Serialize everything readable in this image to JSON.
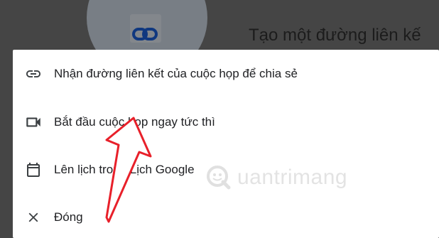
{
  "background": {
    "title": "Tạo một đường liên kế",
    "icon": "link-icon"
  },
  "menu": {
    "items": [
      {
        "label": "Nhận đường liên kết của cuộc họp để chia sẻ",
        "icon": "link-icon"
      },
      {
        "label": "Bắt đầu cuộc họp ngay tức thì",
        "icon": "video-camera-icon"
      },
      {
        "label": "Lên lịch trong Lịch Google",
        "icon": "calendar-icon"
      },
      {
        "label": "Đóng",
        "icon": "close-icon"
      }
    ]
  },
  "watermark": {
    "text": "uantrimang",
    "icon": "quantrimang-logo-icon"
  },
  "annotation": {
    "color": "#e8202a",
    "icon": "red-arrow-icon"
  }
}
